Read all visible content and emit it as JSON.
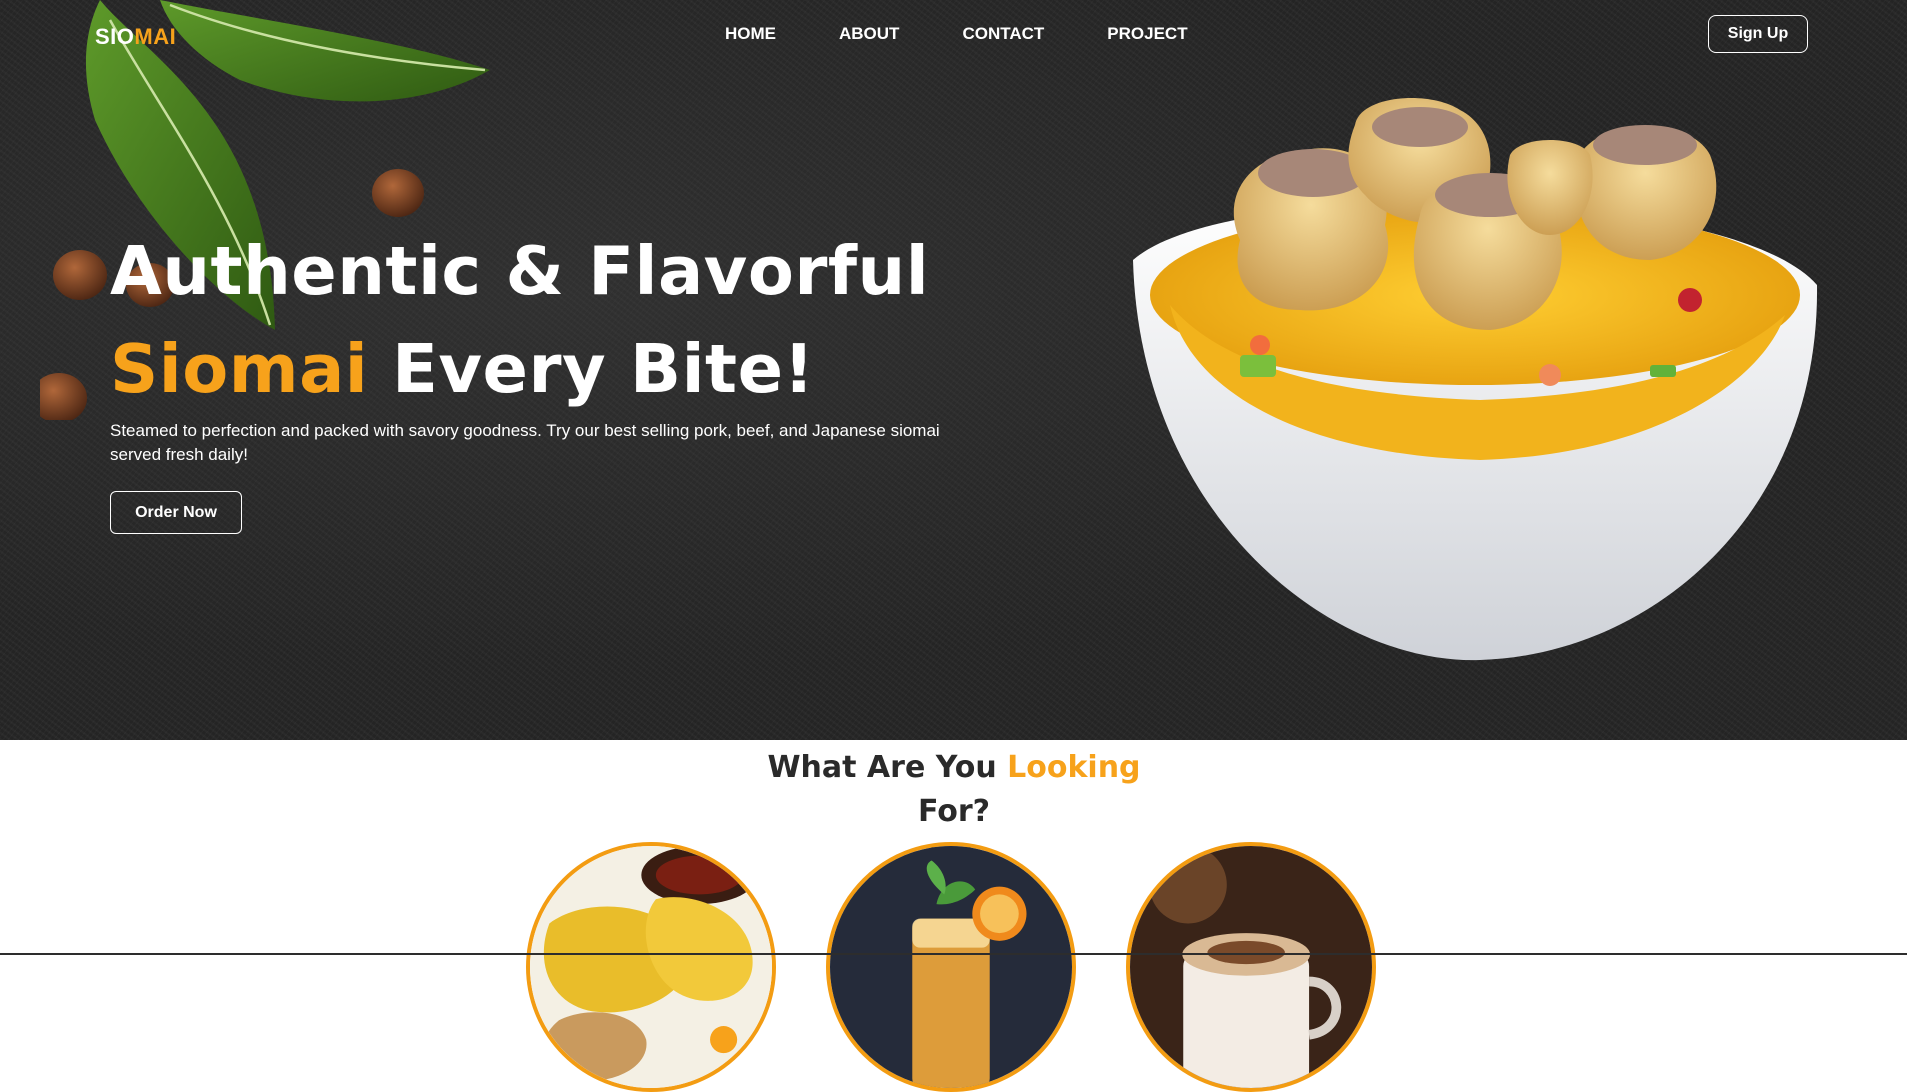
{
  "brand": {
    "part1": "SIO",
    "part2": "MAI"
  },
  "nav": {
    "items": [
      "HOME",
      "ABOUT",
      "CONTACT",
      "PROJECT"
    ],
    "signup_label": "Sign Up"
  },
  "hero": {
    "headline_line1": "Authentic & Flavorful",
    "headline_accent": "Siomai",
    "headline_rest": " Every Bite!",
    "subtext": "Steamed to perfection and packed with savory goodness. Try our best selling pork, beef, and Japanese siomai served fresh daily!",
    "cta_label": "Order Now",
    "image_icon": "siomai-rice-bowl-image",
    "decor_icon": "bay-leaf-decoration"
  },
  "section": {
    "title_part1": "What Are You ",
    "title_accent": "Looking",
    "title_part2": "For?"
  },
  "categories": [
    {
      "icon": "siomai-plate-image"
    },
    {
      "icon": "orange-drink-image"
    },
    {
      "icon": "coffee-cup-image"
    }
  ],
  "colors": {
    "accent": "#f7a21b",
    "hero_bg": "#262626",
    "text_dark": "#2a2a2a",
    "circle_border": "#f39c12"
  }
}
